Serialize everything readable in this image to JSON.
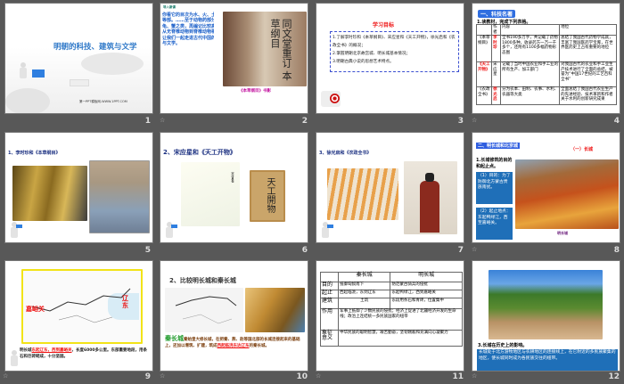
{
  "slides": [
    {
      "number": "1",
      "title": "明朝的科技、建筑与文学",
      "footer": "第一PPT模板网-WWW.1PPT.COM"
    },
    {
      "number": "2",
      "heading": "导入新课",
      "body": "你看它的目次为水、火、土、石、草、木、谷、菜、虫、鱼、禽、兽、人等部。……至于动物药部分的编排，李时珍先编记比较低等的虫、鱼、龟、蟹之类，再编记比较高等的动物禽、兽和人等。这与现代动物分类学从无脊椎动物到脊椎动物相吻合。说明它的分类是科学的、合理的。今天让我们一起走进古代中国的最后的科技、文艺殿堂——明朝的科技、建筑与文学。",
      "caption": "《本草纲目》书影",
      "book_title": "同文堂重订 本草纲目"
    },
    {
      "number": "3",
      "title": "学习目标",
      "goals": [
        "1.了解李时珍和《本草纲目》、宋应星和《天工开物》，徐光启和《农政全书》的概况；",
        "2.掌握明朝北京故宫城、明长城基本情况；",
        "3.明朝古典小说的思想艺术特点。"
      ]
    },
    {
      "number": "4",
      "section": "一、科技名著",
      "instruction": "1.读教材，完成下列表格。",
      "headers": [
        "",
        "作者",
        "内容",
        "地位"
      ],
      "rows": [
        [
          "《本草纲目》",
          "李时珍",
          "全书190多万字，共记载了药物1800多种，收录药方一万一千多个，还附有1100多幅药物形态图",
          "总结了我国古代药物学成就，丰富了我国医药学宝库，在世界医药史上占有重要的地位"
        ],
        [
          "《天工开物》",
          "宋应星",
          "记载了当时中国农业和手工业的所有生产、加工部门",
          "对我国古代的农业和手工业生产技术进行了全面的总结，被誉为“中国17世纪的工艺百科全书”"
        ],
        [
          "《农政全书》",
          "徐光启",
          "分为农本、田制、农事、水利、农器等大类",
          "全面总结了我国古代农业生产的先进经验、技术革新和作者关于水利的创新研究成果"
        ]
      ]
    },
    {
      "number": "5",
      "title": "1、李时珍和《本草纲目》"
    },
    {
      "number": "6",
      "title": "2、宋应星和《天工开物》",
      "book_title": "天工開物",
      "portrait_label": "宋应星像"
    },
    {
      "number": "7",
      "title": "3、徐光启和《农政全书》"
    },
    {
      "number": "8",
      "section": "二、明长城和北京城",
      "subtitle": "（一）长城",
      "question": "1.长城修筑的目的和起止点。",
      "box1": "（1）目的：为了防御北方蒙古贵族南扰。",
      "box2": "（2）起止地点：东起鸭绿江，西至嘉峪关。",
      "caption": "明长城"
    },
    {
      "number": "9",
      "map_label_west": "嘉峪关",
      "map_label_east": "辽东",
      "body_pre": "明长城",
      "body_red": "东起辽东，西到嘉峪关",
      "body_post": "，长度6000多公里。东部重要地段，用条石和巨砖砌成，十分坚固。"
    },
    {
      "number": "10",
      "title": "2、比较明长城和秦长城",
      "term": "秦长城",
      "body_pre": "秦始皇大修长城，在把秦、燕、赵等国北部的长城连接起来的基础上，还加以增筑、扩建，筑成",
      "body_red": "西起临洮东达辽东",
      "body_post": "的秦长城。"
    },
    {
      "number": "11",
      "headers": [
        "",
        "秦长城",
        "明长城"
      ],
      "rows": [
        [
          "目的",
          "抵御匈奴南下",
          "防范蒙古骑兵的侵扰"
        ],
        [
          "起止",
          "西起临洮，东到辽东",
          "东起鸭绿江，西到嘉峪关"
        ],
        [
          "建筑",
          "土筑",
          "东段用条石和青砖，位置集中"
        ],
        [
          "作用",
          "军事上抵御了少数民族的侵扰；经济上促进了北疆经济开发的生命线；政治上连结统一多民族国家的纽带",
          ""
        ],
        [
          "象征意义",
          "中华民族的聪明智慧，艰苦勤奋，坚韧刚毅和充满向心凝聚力",
          ""
        ]
      ]
    },
    {
      "number": "12",
      "question": "3.长城在历史上的影响。",
      "answer": "长城处于北方游牧地区与农耕地区的连接线上，在它附近的多民族聚集的地区，使长城同时成为各民族交往的纽带。"
    }
  ],
  "colors": {
    "background": "#585858",
    "accent_blue": "#1f6fb8",
    "red": "#e11111"
  }
}
